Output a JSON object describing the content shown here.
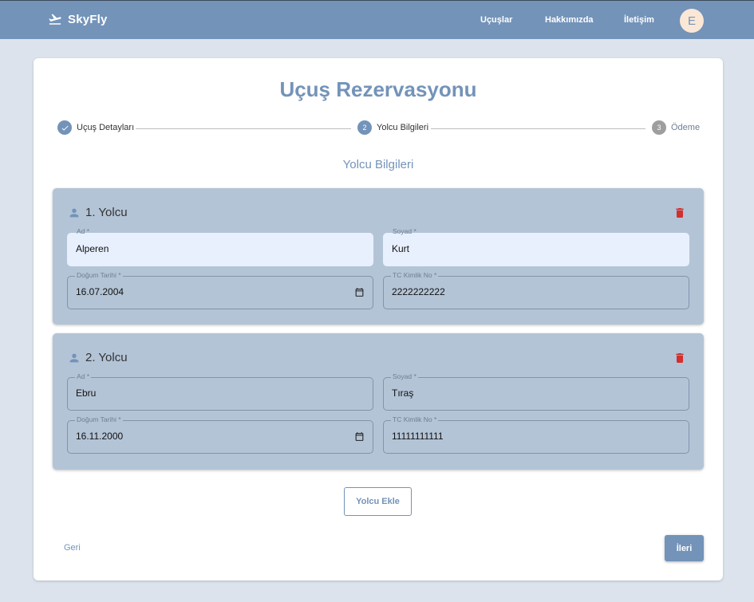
{
  "header": {
    "brand": "SkyFly",
    "nav": [
      "Uçuşlar",
      "Hakkımızda",
      "İletişim"
    ],
    "avatar_letter": "E"
  },
  "page": {
    "title": "Uçuş Rezervasyonu",
    "section_title": "Yolcu Bilgileri"
  },
  "stepper": [
    {
      "number": "1",
      "label": "Uçuş Detayları",
      "state": "completed"
    },
    {
      "number": "2",
      "label": "Yolcu Bilgileri",
      "state": "active"
    },
    {
      "number": "3",
      "label": "Ödeme",
      "state": "pending"
    }
  ],
  "field_labels": {
    "first_name": "Ad *",
    "last_name": "Soyad *",
    "birth_date": "Doğum Tarihi *",
    "tc_no": "TC Kimlik No *"
  },
  "passengers": [
    {
      "title": "1. Yolcu",
      "first_name": "Alperen",
      "last_name": "Kurt",
      "birth_date": "16.07.2004",
      "tc_no": "2222222222"
    },
    {
      "title": "2. Yolcu",
      "first_name": "Ebru",
      "last_name": "Tıraş",
      "birth_date": "16.11.2000",
      "tc_no": "11111111111"
    }
  ],
  "buttons": {
    "add_passenger": "Yolcu Ekle",
    "back": "Geri",
    "next": "İleri"
  },
  "colors": {
    "primary": "#7393b9",
    "panel": "#b3c4d6",
    "delete": "#d32f2f",
    "step_pending": "#9e9e9e"
  }
}
